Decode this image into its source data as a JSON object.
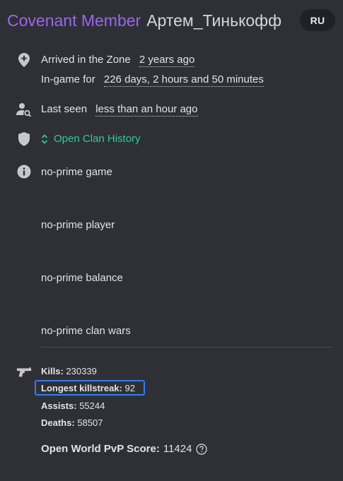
{
  "header": {
    "rank": "Covenant Member",
    "nickname": "Артем_Тинькофф",
    "language_badge": "RU"
  },
  "zone": {
    "arrived_label": "Arrived in the Zone",
    "arrived_value": "2 years ago",
    "ingame_label": "In-game for",
    "ingame_value": "226 days, 2 hours and 50 minutes"
  },
  "last_seen": {
    "label": "Last seen",
    "value": "less than an hour ago"
  },
  "clan": {
    "link_label": "Open Clan History"
  },
  "info": {
    "items": [
      "no-prime game",
      "no-prime player",
      "no-prime balance",
      "no-prime clan wars"
    ]
  },
  "stats": {
    "kills_label": "Kills:",
    "kills_value": "230339",
    "killstreak_label": "Longest killstreak:",
    "killstreak_value": "92",
    "assists_label": "Assists:",
    "assists_value": "55244",
    "deaths_label": "Deaths:",
    "deaths_value": "58507",
    "pvp_label": "Open World PvP Score:",
    "pvp_value": "11424"
  },
  "colors": {
    "background": "#2f3036",
    "rank": "#9a66ee",
    "link": "#2fc9a0",
    "highlight": "#2f7ff0"
  },
  "icons": [
    "map-pin-plus-icon",
    "user-search-icon",
    "shield-icon",
    "chevron-up-down-icon",
    "info-icon",
    "pistol-icon",
    "help-circle-icon"
  ]
}
